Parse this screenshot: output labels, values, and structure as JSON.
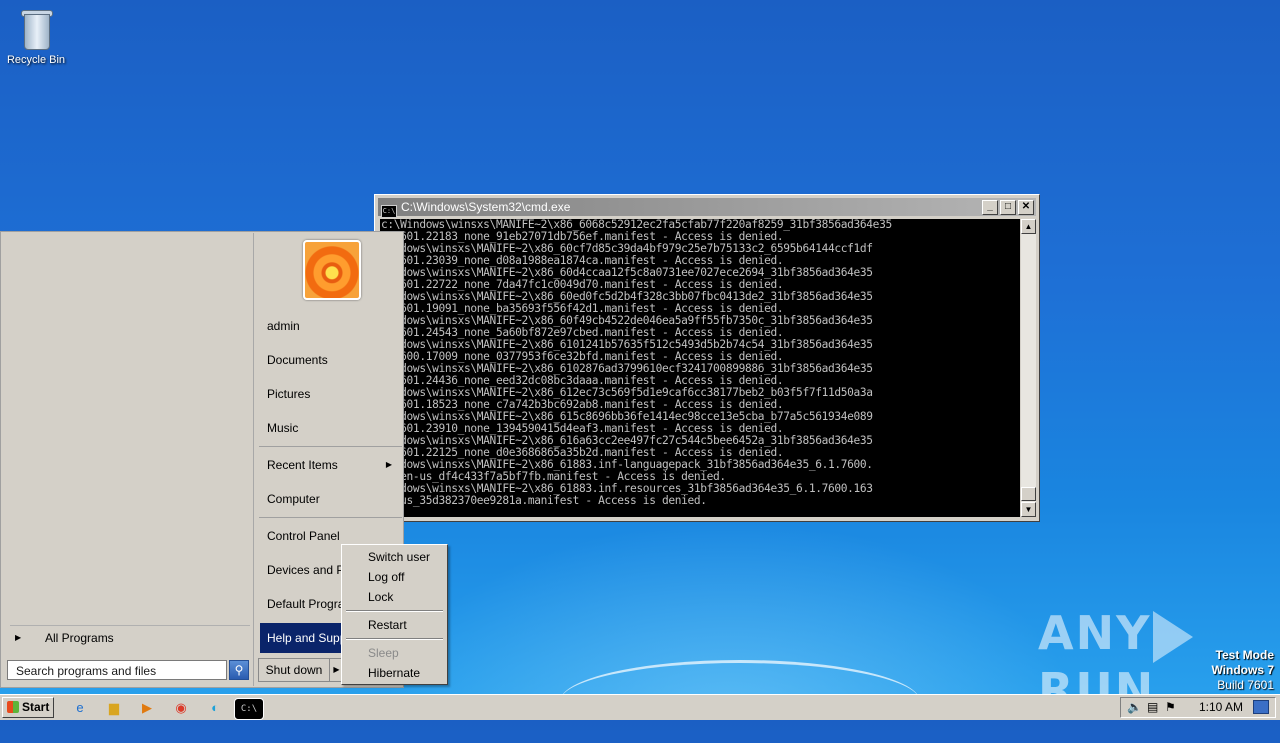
{
  "desktop": {
    "recycle_bin_label": "Recycle Bin"
  },
  "cmd": {
    "title": "C:\\Windows\\System32\\cmd.exe",
    "lines": [
      "c:\\Windows\\winsxs\\MANIFE~2\\x86_6068c52912ec2fa5cfab77f220af8259_31bf3856ad364e35",
      "1.7601.22183_none_91eb27071db756ef.manifest - Access is denied.",
      "Windows\\winsxs\\MANIFE~2\\x86_60cf7d85c39da4bf979c25e7b75133c2_6595b64144ccf1df",
      "0.7601.23039_none_d08a1988ea1874ca.manifest - Access is denied.",
      "Windows\\winsxs\\MANIFE~2\\x86_60d4ccaa12f5c8a0731ee7027ece2694_31bf3856ad364e35",
      "1.7601.22722_none_7da47fc1c0049d70.manifest - Access is denied.",
      "Windows\\winsxs\\MANIFE~2\\x86_60ed0fc5d2b4f328c3bb07fbc0413de2_31bf3856ad364e35",
      "1.7601.19091_none_ba35693f556f42d1.manifest - Access is denied.",
      "Windows\\winsxs\\MANIFE~2\\x86_60f49cb4522de046ea5a9ff55fb7350c_31bf3856ad364e35",
      "1.7601.24543_none_5a60bf872e97cbed.manifest - Access is denied.",
      "Windows\\winsxs\\MANIFE~2\\x86_6101241b57635f512c5493d5b2b74c54_31bf3856ad364e35",
      "1.7600.17009_none_0377953f6ce32bfd.manifest - Access is denied.",
      "Windows\\winsxs\\MANIFE~2\\x86_6102876ad3799610ecf3241700899886_31bf3856ad364e35",
      "5.7601.24436_none_eed32dc08bc3daaa.manifest - Access is denied.",
      "Windows\\winsxs\\MANIFE~2\\x86_612ec73c569f5d1e9caf6cc38177beb2_b03f5f7f11d50a3a",
      "1.7601.18523_none_c7a742b3bc692ab8.manifest - Access is denied.",
      "Windows\\winsxs\\MANIFE~2\\x86_615c8696bb36fe1414ec98cce13e5cba_b77a5c561934e089",
      "1.7601.23910_none_1394590415d4eaf3.manifest - Access is denied.",
      "Windows\\winsxs\\MANIFE~2\\x86_616a63cc2ee497fc27c544c5bee6452a_31bf3856ad364e35",
      "1.7601.22125_none_d0e3686865a35b2d.manifest - Access is denied.",
      "Windows\\winsxs\\MANIFE~2\\x86_61883.inf-languagepack_31bf3856ad364e35_6.1.7600.",
      "85_en-us_df4c433f7a5bf7fb.manifest - Access is denied.",
      "Windows\\winsxs\\MANIFE~2\\x86_61883.inf.resources_31bf3856ad364e35_6.1.7600.163",
      "en-us_35d382370ee9281a.manifest - Access is denied."
    ]
  },
  "start_menu": {
    "all_programs": "All Programs",
    "search_placeholder": "Search programs and files",
    "right_items": [
      "admin",
      "Documents",
      "Pictures",
      "Music",
      "Recent Items",
      "Computer",
      "Control Panel",
      "Devices and Pri",
      "Default Progra",
      "Help and Suppo"
    ],
    "shutdown_label": "Shut down"
  },
  "shutdown_submenu": {
    "items": [
      "Switch user",
      "Log off",
      "Lock",
      "Restart",
      "Sleep",
      "Hibernate"
    ]
  },
  "watermark": {
    "text_left": "ANY",
    "text_right": "RUN"
  },
  "test_mode": {
    "line1": "Test Mode",
    "line2": "Windows 7",
    "line3": "Build 7601"
  },
  "taskbar": {
    "start_label": "Start",
    "clock": "1:10 AM"
  }
}
